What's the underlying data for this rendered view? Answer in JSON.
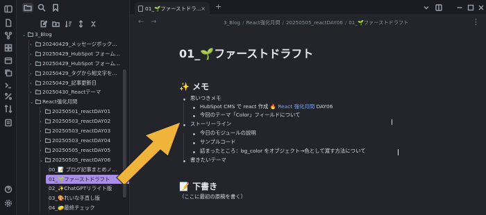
{
  "app": {
    "accent_color": "#a98ee6",
    "arrow_color": "#f0b43a"
  },
  "ribbon": {
    "icons": [
      "sidebar-toggle-icon",
      "files-icon",
      "graph-icon",
      "canvas-icon",
      "calendar-icon",
      "copy-icon",
      "terminal-icon",
      "percent-icon",
      "sync-icon",
      "help-icon",
      "settings-icon"
    ]
  },
  "sidebar": {
    "tree": [
      {
        "label": "3_Blog",
        "level": 0,
        "open": true,
        "icon": "🏞️"
      },
      {
        "label": "20240429_メッセージボック…",
        "level": 1,
        "open": false
      },
      {
        "label": "20250429_HubSpot フォーム…",
        "level": 1,
        "open": false
      },
      {
        "label": "20250429_HubSpot フォーム…",
        "level": 1,
        "open": false
      },
      {
        "label": "20250429_タグから組文字を…",
        "level": 1,
        "open": false
      },
      {
        "label": "20250429_記事更新日",
        "level": 1,
        "open": false
      },
      {
        "label": "20250430_Reactテーマ",
        "level": 1,
        "open": false
      },
      {
        "label": "React強化月間",
        "level": 1,
        "open": true
      },
      {
        "label": "20250501_reactDAY01",
        "level": 2,
        "open": false
      },
      {
        "label": "20250503_reactDAY02",
        "level": 2,
        "open": false
      },
      {
        "label": "20250503_reactDAY03",
        "level": 2,
        "open": false
      },
      {
        "label": "20250503_reactDAY04",
        "level": 2,
        "open": false
      },
      {
        "label": "20250505_reactDAY05",
        "level": 2,
        "open": false
      },
      {
        "label": "20250505_reactDAY06",
        "level": 2,
        "open": true
      },
      {
        "label": "00_📝 ブログ記事まとめノ…",
        "level": 3,
        "file": true
      },
      {
        "label": "01_🌱ファーストドラフト",
        "level": 3,
        "file": true,
        "selected": true
      },
      {
        "label": "02_✨ChatGPTリライト版",
        "level": 3,
        "file": true
      },
      {
        "label": "03_🎨れいな手直し版",
        "level": 3,
        "file": true
      },
      {
        "label": "04_🧽最終チェック",
        "level": 3,
        "file": true
      }
    ]
  },
  "tab": {
    "title": "01_🌱ファーストドラ…",
    "close": "×",
    "new_tab": "+"
  },
  "breadcrumb": {
    "items": [
      "3_Blog",
      "React強化月間",
      "20250505_reactDAY06",
      "01_🌱ファーストドラフト"
    ],
    "separator": "/"
  },
  "document": {
    "title": "01_🌱ファーストドラフト",
    "memo_heading": "✨ メモ",
    "b1": "思いつきメモ",
    "b1_1_prefix": "HubSpot CMS で react 作成 🔥 ",
    "b1_1_highlight": "React 強化月間",
    "b1_1_suffix": " DAY06",
    "b1_2": "今回のテーマ「Color」フィールドについて",
    "b2": "ストーリーライン",
    "b2_1": "今日のモジュールの説明",
    "b2_2": "サンプルコード",
    "b2_3": "詰まったところ：bg_color をオブジェクト→色として渡す方法について",
    "b3": "書きたいテーマ",
    "draft_heading": "📝 下書き",
    "draft_note": "（ここに最初の原稿を書く）"
  }
}
